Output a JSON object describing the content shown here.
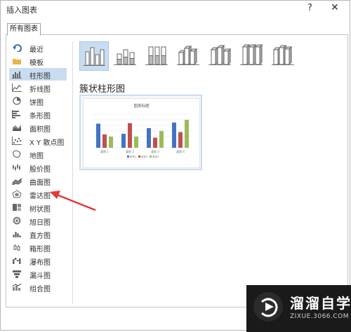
{
  "window": {
    "title": "插入图表",
    "help": "?",
    "close": "✕"
  },
  "tabs": [
    {
      "label": "所有图表"
    }
  ],
  "categories": [
    {
      "label": "最近",
      "icon": "recent-icon"
    },
    {
      "label": "模板",
      "icon": "folder-icon"
    },
    {
      "label": "柱形图",
      "icon": "column-chart-icon",
      "selected": true
    },
    {
      "label": "折线图",
      "icon": "line-chart-icon"
    },
    {
      "label": "饼图",
      "icon": "pie-chart-icon"
    },
    {
      "label": "条形图",
      "icon": "bar-chart-icon"
    },
    {
      "label": "面积图",
      "icon": "area-chart-icon"
    },
    {
      "label": "X Y 散点图",
      "icon": "scatter-chart-icon"
    },
    {
      "label": "地图",
      "icon": "map-chart-icon"
    },
    {
      "label": "股价图",
      "icon": "stock-chart-icon"
    },
    {
      "label": "曲面图",
      "icon": "surface-chart-icon"
    },
    {
      "label": "雷达图",
      "icon": "radar-chart-icon"
    },
    {
      "label": "树状图",
      "icon": "treemap-chart-icon"
    },
    {
      "label": "旭日图",
      "icon": "sunburst-chart-icon"
    },
    {
      "label": "直方图",
      "icon": "histogram-chart-icon"
    },
    {
      "label": "箱形图",
      "icon": "boxwhisker-chart-icon"
    },
    {
      "label": "瀑布图",
      "icon": "waterfall-chart-icon"
    },
    {
      "label": "漏斗图",
      "icon": "funnel-chart-icon"
    },
    {
      "label": "组合图",
      "icon": "combo-chart-icon"
    }
  ],
  "subtypes": [
    {
      "icon": "clustered-column-icon",
      "selected": true
    },
    {
      "icon": "stacked-column-icon"
    },
    {
      "icon": "100-stacked-column-icon"
    },
    {
      "icon": "3d-clustered-column-icon"
    },
    {
      "icon": "3d-stacked-column-icon"
    },
    {
      "icon": "3d-100-stacked-column-icon"
    },
    {
      "icon": "3d-column-icon"
    }
  ],
  "subtype_title": "簇状柱形图",
  "preview": {
    "chart_title": "图表标题",
    "categories": [
      "类别 1",
      "类别 2",
      "类别 3",
      "类别 4"
    ],
    "legend": [
      "系列1",
      "系列2",
      "系列3"
    ]
  },
  "chart_data": {
    "type": "bar",
    "title": "图表标题",
    "categories": [
      "类别 1",
      "类别 2",
      "类别 3",
      "类别 4"
    ],
    "series": [
      {
        "name": "系列1",
        "values": [
          4.3,
          2.5,
          3.5,
          4.5
        ]
      },
      {
        "name": "系列2",
        "values": [
          2.4,
          4.4,
          1.8,
          2.8
        ]
      },
      {
        "name": "系列3",
        "values": [
          2.0,
          2.0,
          3.0,
          5.0
        ]
      }
    ],
    "ylim": [
      0,
      6
    ],
    "colors": [
      "#4472c4",
      "#c0504d",
      "#9bbb59"
    ],
    "legend_position": "bottom"
  },
  "watermark": {
    "brand": "溜溜自学",
    "url": "ZIXUE.3066.COM"
  },
  "colors": {
    "selected": "#c9ddf2",
    "annotation_arrow": "#e0393a"
  }
}
